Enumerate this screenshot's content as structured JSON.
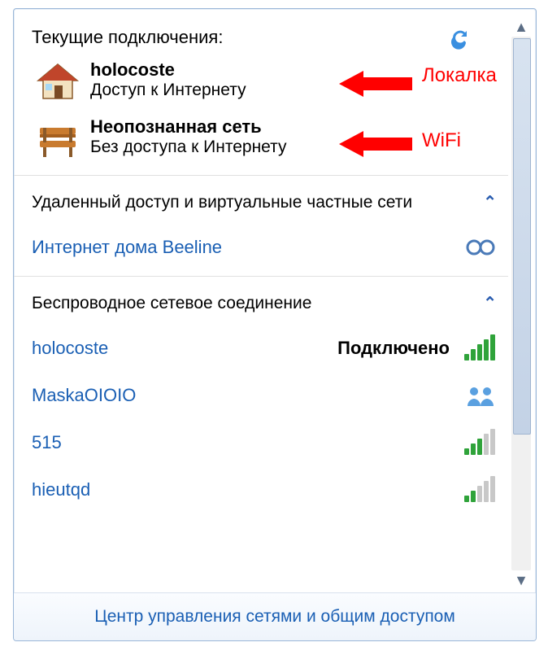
{
  "header": {
    "title": "Текущие подключения:"
  },
  "current_connections": [
    {
      "name": "holocoste",
      "status": "Доступ к Интернету",
      "icon": "house-icon",
      "annotation": "Локалка"
    },
    {
      "name": "Неопознанная сеть",
      "status": "Без доступа к Интернету",
      "icon": "bench-icon",
      "annotation": "WiFi"
    }
  ],
  "sections": {
    "dialup_vpn": {
      "title": "Удаленный доступ и виртуальные частные сети",
      "items": [
        {
          "name": "Интернет дома Beeline"
        }
      ]
    },
    "wireless": {
      "title": "Беспроводное сетевое соединение",
      "items": [
        {
          "name": "holocoste",
          "status": "Подключено",
          "signal": 5,
          "shared": false
        },
        {
          "name": "MaskaOIOIO",
          "status": "",
          "signal": 0,
          "shared": true
        },
        {
          "name": "515",
          "status": "",
          "signal": 3,
          "shared": false
        },
        {
          "name": "hieutqd",
          "status": "",
          "signal": 2,
          "shared": false
        }
      ]
    }
  },
  "footer": {
    "link": "Центр управления сетями и общим доступом"
  },
  "colors": {
    "link": "#1a5fb4",
    "annotation": "#ff0000"
  }
}
